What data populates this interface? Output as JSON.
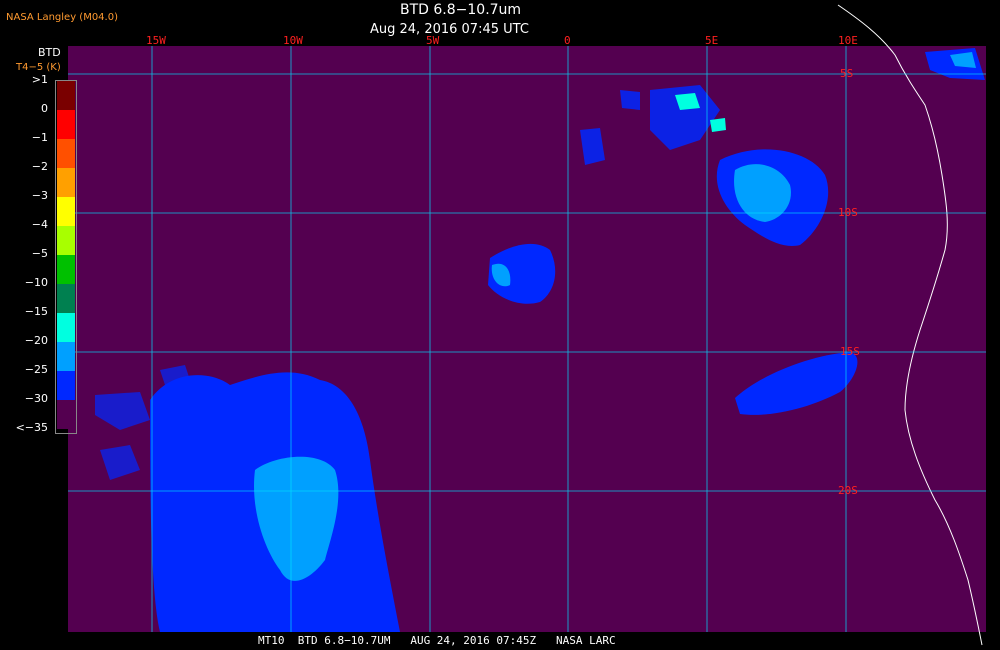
{
  "header": {
    "title": "BTD 6.8−10.7um",
    "subtitle": "Aug 24, 2016 07:45 UTC",
    "credit": "NASA Langley (M04.0)"
  },
  "legend": {
    "title": "BTD",
    "units": "T4−5 (K)",
    "ticks": [
      ">1",
      "0",
      "−1",
      "−2",
      "−3",
      "−4",
      "−5",
      "−10",
      "−15",
      "−20",
      "−25",
      "−30",
      "<−35"
    ],
    "colors": [
      "#7a0000",
      "#ff0000",
      "#ff5000",
      "#ffa000",
      "#ffff00",
      "#a8ff00",
      "#00c000",
      "#008050",
      "#00ffe0",
      "#00a0ff",
      "#0028ff",
      "#540050"
    ]
  },
  "grid": {
    "lon_labels": [
      "15W",
      "10W",
      "5W",
      "0",
      "5E",
      "10E"
    ],
    "lat_labels": [
      "5S",
      "10S",
      "15S",
      "20S"
    ]
  },
  "colors": {
    "background": "#540050",
    "grid": "#00e0ff",
    "coast": "#ffffff",
    "cloud_deep": "#0028ff",
    "cloud_mid": "#00a0ff",
    "cloud_light": "#00ffe0"
  },
  "footer": {
    "text": "MT10  BTD 6.8−10.7UM   AUG 24, 2016 07:45Z   NASA LARC"
  }
}
